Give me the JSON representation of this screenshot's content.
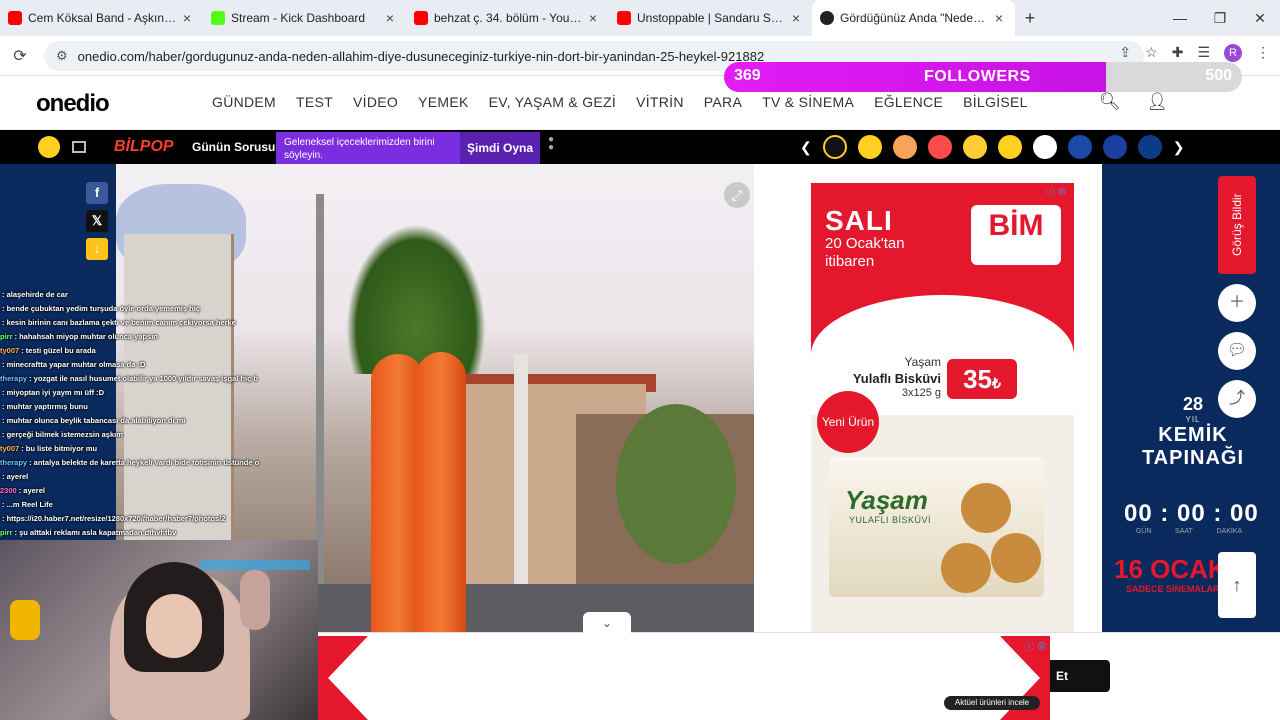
{
  "browser": {
    "tabs": [
      {
        "title": "Cem Köksal Band - Aşkına Elveda",
        "color": "#ff0000"
      },
      {
        "title": "Stream - Kick Dashboard",
        "color": "#53fc18"
      },
      {
        "title": "behzat ç. 34. bölüm - YouTube",
        "color": "#ff0000"
      },
      {
        "title": "Unstoppable | Sandaru Sathsara",
        "color": "#ff0000"
      },
      {
        "title": "Gördüğünüz Anda \"Neden Allah",
        "color": "#222222"
      }
    ],
    "url": "onedio.com/haber/gordugunuz-anda-neden-allahim-diye-dusuneceginiz-turkiye-nin-dort-bir-yanindan-25-heykel-921882",
    "profile_initial": "R"
  },
  "followers": {
    "current": "369",
    "label": "FOLLOWERS",
    "goal": "500",
    "progress": 0.738
  },
  "site": {
    "logo": "onedio",
    "menu": [
      "GÜNDEM",
      "TEST",
      "VİDEO",
      "YEMEK",
      "EV, YAŞAM & GEZİ",
      "VİTRİN",
      "PARA",
      "TV & SİNEMA",
      "EĞLENCE",
      "BİLGİSEL"
    ]
  },
  "strip": {
    "bilpop": "BİLPOP",
    "gunun": "Günün Sorusu",
    "question": "Geleneksel içeceklerimizden birini söyleyin.",
    "play": "Şimdi Oyna"
  },
  "ad": {
    "sali": "SALI",
    "ocak": "20 Ocak'tan",
    "itibaren": "itibaren",
    "brand": "BİM",
    "brand_sub": "Kalbimde Benim",
    "product_line1": "Yaşam",
    "product_line2": "Yulaflı Bisküvi",
    "product_gram": "3x125 g",
    "price": "35",
    "new_badge": "Yeni Ürün",
    "pack_title": "Yaşam",
    "pack_sub": "YULAFLI BİSKÜVİ"
  },
  "right_panel": {
    "gorus": "Görüş Bildir",
    "anniversary": "28",
    "anniversary_sub": "YIL",
    "event_title1": "KEMİK",
    "event_title2": "TAPINAĞI",
    "timer": "00 : 00 : 00",
    "timer_labels": [
      "GÜN",
      "SAAT",
      "DAKİKA"
    ],
    "date": "16 OCAK",
    "date_sub": "SADECE SİNEMALARDA"
  },
  "bottom": {
    "aktuel": "Aktüel ürünleri incele",
    "et": "Et"
  },
  "chat": [
    {
      "user": "",
      "msg": ": alaşehirde de car",
      "color": "#ffffff"
    },
    {
      "user": "",
      "msg": ": bende çubuktan yedim turşuda öyle orda yememiş hiç",
      "color": "#ff6bd1"
    },
    {
      "user": "",
      "msg": ": kesin birinin canı bazlama çekti ve benim canım çekiyorsa herke",
      "color": "#ff4d4d"
    },
    {
      "user": "pirr",
      "msg": ": hahahsah miyop muhtar olunca yapsın",
      "color": "#6bff6b"
    },
    {
      "user": "ty007",
      "msg": ": testi güzel bu arada",
      "color": "#ffb84d"
    },
    {
      "user": "",
      "msg": ": minecraftta yapar muhtar olmasa da :D",
      "color": "#6bc7ff"
    },
    {
      "user": "therapy",
      "msg": ": yozgat ile nasıl husumet olabilir ya 1000 yıldır savaş işgal hiç b",
      "color": "#6bc7ff"
    },
    {
      "user": "",
      "msg": ": miyoptan iyi yaym mı üff :D",
      "color": "#ffffff"
    },
    {
      "user": "",
      "msg": ": muhtar yaptırmış bunu",
      "color": "#ffffff"
    },
    {
      "user": "",
      "msg": ": muhtar olunca beylik tabancası da alabiliyon di mi",
      "color": "#ffb84d"
    },
    {
      "user": "",
      "msg": ": gerçeği bilmek istemezsin aşkım",
      "color": "#ff4d4d"
    },
    {
      "user": "ty007",
      "msg": ": bu liste bitmiyor mu",
      "color": "#ffb84d"
    },
    {
      "user": "therapy",
      "msg": ": antalya belekte de karetta heykeli vardı bide totişinin üstünde o",
      "color": "#6bc7ff"
    },
    {
      "user": "",
      "msg": ": ayerel",
      "color": "#ffffff"
    },
    {
      "user": "2300",
      "msg": ": ayerel",
      "color": "#ff6bd1"
    },
    {
      "user": "",
      "msg": ": ...m Reel Life",
      "color": "#ffffff"
    },
    {
      "user": "",
      "msg": ": https://i20.haber7.net/resize/1280x720//haber/haber7/photos/2",
      "color": "#ff4d4d"
    },
    {
      "user": "pirr",
      "msg": ": şu alttaki reklamı asla kapatmadan dfhvhfbv",
      "color": "#6bff6b"
    }
  ]
}
